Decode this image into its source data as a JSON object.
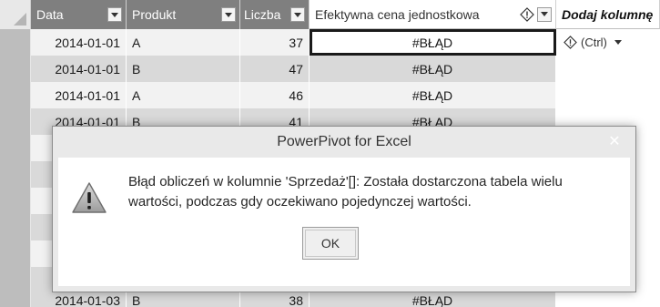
{
  "columns": {
    "date": "Data",
    "product": "Produkt",
    "qty": "Liczba",
    "effective_price": "Efektywna cena jednostkowa",
    "add_column": "Dodaj kolumnę"
  },
  "rows": [
    {
      "date": "2014-01-01",
      "product": "A",
      "qty": "37",
      "eff": "#BŁĄD"
    },
    {
      "date": "2014-01-01",
      "product": "B",
      "qty": "47",
      "eff": "#BŁĄD"
    },
    {
      "date": "2014-01-01",
      "product": "A",
      "qty": "46",
      "eff": "#BŁĄD"
    },
    {
      "date": "2014-01-01",
      "product": "B",
      "qty": "41",
      "eff": "#BŁĄD"
    }
  ],
  "last_row": {
    "date": "2014-01-03",
    "product": "B",
    "qty": "38",
    "eff": "#BŁĄD"
  },
  "paste_options": {
    "label": "(Ctrl)"
  },
  "dialog": {
    "title": "PowerPivot for Excel",
    "close_glyph": "✕",
    "message": "Błąd obliczeń w kolumnie 'Sprzedaż'[]: Została dostarczona tabela wielu wartości, podczas gdy oczekiwano pojedynczej wartości.",
    "ok_label": "OK"
  },
  "colors": {
    "header_bg": "#7f7f7f",
    "band_light": "#f2f2f2",
    "band_dark": "#d9d9d9",
    "dialog_title_bg": "#e9e9e9"
  },
  "icons": {
    "warning": "warning-triangle-icon",
    "small_warning": "diamond-warning-icon",
    "dropdown": "chevron-down-icon"
  }
}
